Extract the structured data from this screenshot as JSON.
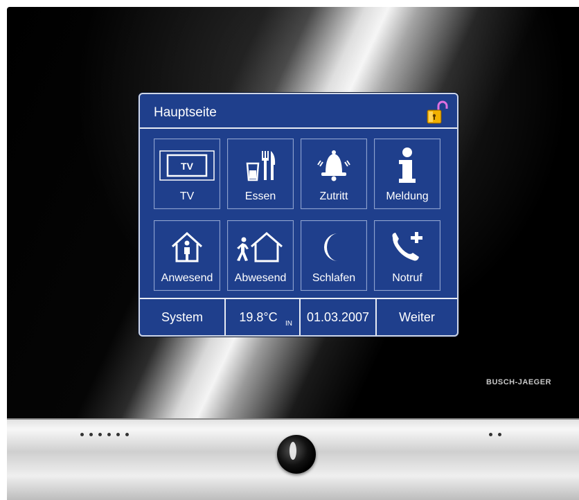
{
  "screen": {
    "title": "Hauptseite",
    "tiles": [
      {
        "label": "TV",
        "icon": "tv-icon",
        "tv_text": "TV"
      },
      {
        "label": "Essen",
        "icon": "dining-icon"
      },
      {
        "label": "Zutritt",
        "icon": "bell-icon"
      },
      {
        "label": "Meldung",
        "icon": "info-icon"
      },
      {
        "label": "Anwesend",
        "icon": "house-person-icon"
      },
      {
        "label": "Abwesend",
        "icon": "house-leaving-icon"
      },
      {
        "label": "Schlafen",
        "icon": "moon-icon"
      },
      {
        "label": "Notruf",
        "icon": "emergency-phone-icon"
      }
    ],
    "status": {
      "system_label": "System",
      "temperature": "19.8°C",
      "temperature_unit": "IN",
      "date": "01.03.2007",
      "next_label": "Weiter"
    }
  },
  "device": {
    "brand": "BUSCH-JAEGER"
  },
  "colors": {
    "screen_bg": "#1f3f8c",
    "lock_gold": "#f2b100",
    "lock_shackle": "#e070e0"
  }
}
